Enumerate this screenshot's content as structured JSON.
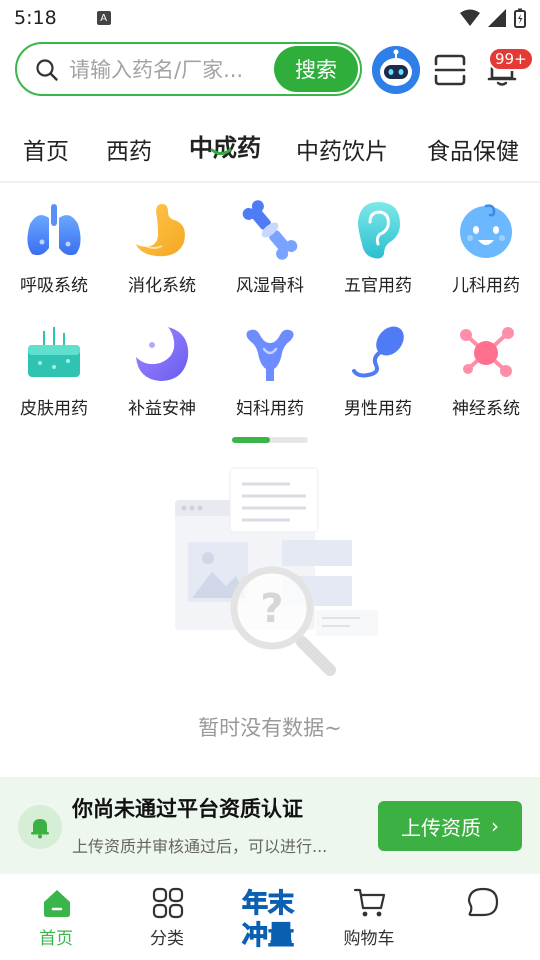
{
  "status_bar": {
    "time": "5:18",
    "notification_letter": "A"
  },
  "search": {
    "placeholder": "请输入药名/厂家...",
    "button_label": "搜索"
  },
  "header": {
    "notification_badge": "99+"
  },
  "tabs": [
    {
      "label": "首页",
      "active": false
    },
    {
      "label": "西药",
      "active": false
    },
    {
      "label": "中成药",
      "active": true
    },
    {
      "label": "中药饮片",
      "active": false
    },
    {
      "label": "食品保健",
      "active": false
    }
  ],
  "categories": [
    {
      "label": "呼吸系统",
      "icon": "lungs-icon"
    },
    {
      "label": "消化系统",
      "icon": "stomach-icon"
    },
    {
      "label": "风湿骨科",
      "icon": "bone-joint-icon"
    },
    {
      "label": "五官用药",
      "icon": "ear-icon"
    },
    {
      "label": "儿科用药",
      "icon": "baby-face-icon"
    },
    {
      "label": "皮肤用药",
      "icon": "skin-icon"
    },
    {
      "label": "补益安神",
      "icon": "moon-icon"
    },
    {
      "label": "妇科用药",
      "icon": "uterus-icon"
    },
    {
      "label": "男性用药",
      "icon": "sperm-icon"
    },
    {
      "label": "神经系统",
      "icon": "neuron-icon"
    }
  ],
  "category_scroll_fraction": 0.5,
  "empty_state": {
    "text": "暂时没有数据~"
  },
  "notice": {
    "title": "你尚未通过平台资质认证",
    "subtitle": "上传资质并审核通过后，可以进行...",
    "button_label": "上传资质",
    "button_arrow": "›"
  },
  "bottom_nav": [
    {
      "label": "首页",
      "icon": "home-icon",
      "active": true
    },
    {
      "label": "分类",
      "icon": "grid-icon",
      "active": false
    },
    {
      "label": "",
      "icon": "year-end-promo-icon",
      "active": false
    },
    {
      "label": "购物车",
      "icon": "cart-icon",
      "active": false
    },
    {
      "label": "",
      "icon": "chat-bubble-icon",
      "active": false
    }
  ],
  "promo": {
    "line1": "年末",
    "line2": "冲量"
  },
  "colors": {
    "brand_green": "#39b54a",
    "badge_red": "#e53935",
    "notice_bg": "#eef7ee"
  }
}
